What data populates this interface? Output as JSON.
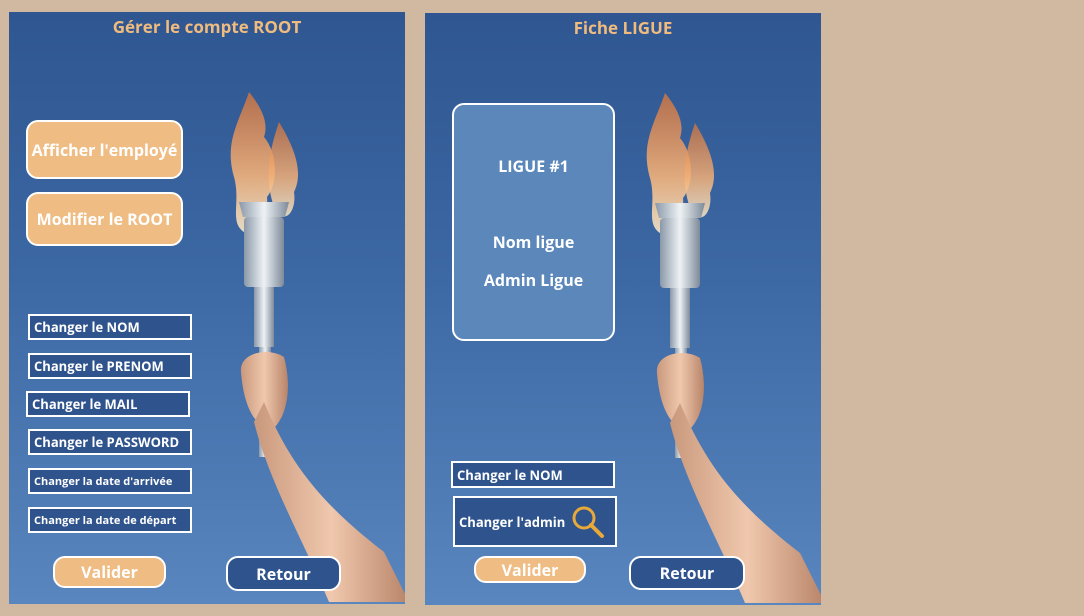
{
  "root_panel": {
    "title": "Gérer le compte ROOT",
    "buttons": {
      "show_employee": "Afficher l'employé",
      "modify_root": "Modifier le ROOT"
    },
    "fields": [
      "Changer le NOM",
      "Changer le PRENOM",
      "Changer le MAIL",
      "Changer le PASSWORD",
      "Changer la date d'arrivée",
      "Changer la date de départ"
    ],
    "validate": "Valider",
    "back": "Retour"
  },
  "league_panel": {
    "title": "Fiche LIGUE",
    "card": {
      "league_id": "LIGUE #1",
      "league_name": "Nom ligue",
      "league_admin": "Admin Ligue"
    },
    "change_name": "Changer le NOM",
    "change_admin": "Changer l'admin",
    "validate": "Valider",
    "back": "Retour"
  },
  "colors": {
    "background": "#d1b8a0",
    "accent_orange": "#efbd84",
    "title_orange": "#efbb7f",
    "dark_blue": "#2f538c",
    "card_blue": "#5b87bb"
  }
}
